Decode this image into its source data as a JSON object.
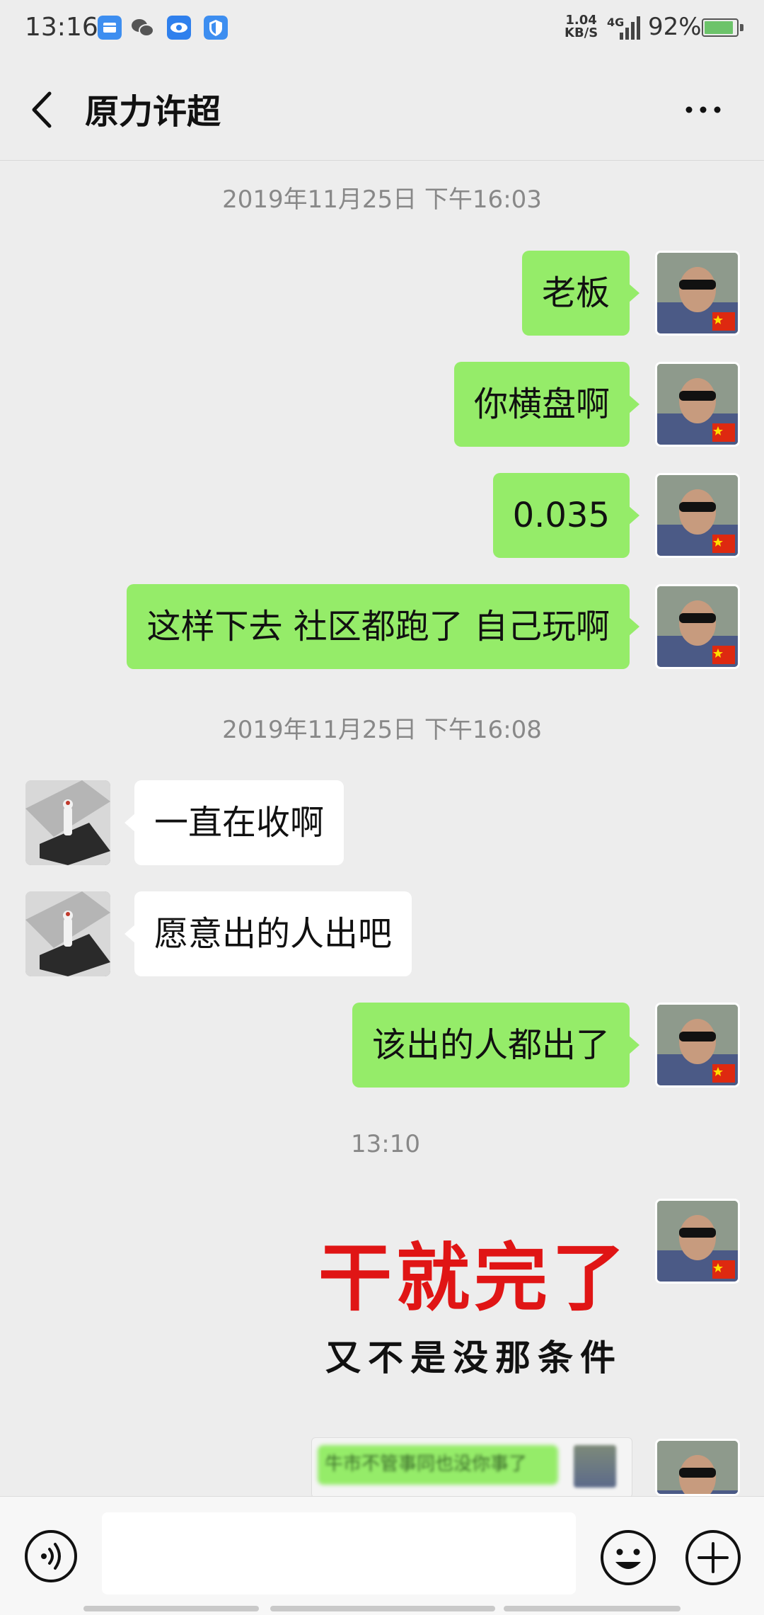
{
  "status_bar": {
    "time": "13:16",
    "net_speed_value": "1.04",
    "net_speed_unit": "KB/S",
    "network_type": "4G",
    "battery_percent": "92%",
    "battery_level": 0.92,
    "notification_icons": [
      "gallery-app-icon",
      "wechat-icon",
      "eye-app-icon",
      "shield-app-icon"
    ]
  },
  "header": {
    "title": "原力许超"
  },
  "messages": [
    {
      "type": "timestamp",
      "text": "2019年11月25日 下午16:03"
    },
    {
      "type": "text",
      "sender": "me",
      "text": "老板"
    },
    {
      "type": "text",
      "sender": "me",
      "text": "你横盘啊"
    },
    {
      "type": "text",
      "sender": "me",
      "text": "0.035"
    },
    {
      "type": "text",
      "sender": "me",
      "text": "这样下去 社区都跑了 自己玩啊"
    },
    {
      "type": "timestamp",
      "text": "2019年11月25日 下午16:08"
    },
    {
      "type": "text",
      "sender": "other",
      "text": "一直在收啊"
    },
    {
      "type": "text",
      "sender": "other",
      "text": "愿意出的人出吧"
    },
    {
      "type": "text",
      "sender": "me",
      "text": "该出的人都出了"
    },
    {
      "type": "timestamp",
      "text": "13:10"
    },
    {
      "type": "sticker",
      "sender": "me",
      "line1": "干就完了",
      "line2": "又不是没那条件"
    },
    {
      "type": "image",
      "sender": "me",
      "blurred_text": "牛市不管事同也没你事了"
    }
  ],
  "input_bar": {
    "placeholder": ""
  }
}
